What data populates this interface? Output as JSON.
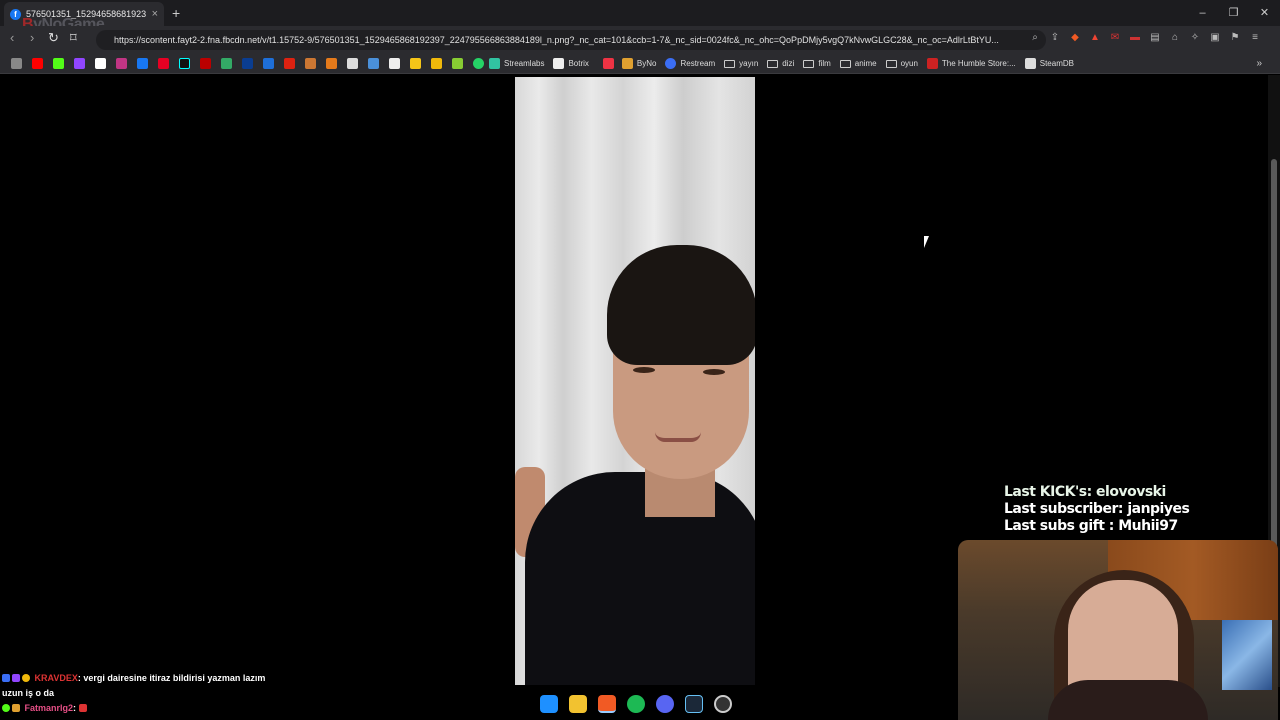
{
  "tab": {
    "title": "576501351_1529465868192397",
    "close": "×",
    "new": "+"
  },
  "watermark": {
    "part1": "B",
    "part2": "yNoGame"
  },
  "window": {
    "minimize": "–",
    "restore": "❐",
    "close": "✕"
  },
  "address": {
    "url": "https://scontent.fayt2-2.fna.fbcdn.net/v/t1.15752-9/576501351_1529465868192397_224795566863884189l_n.png?_nc_cat=101&ccb=1-7&_nc_sid=0024fc&_nc_ohc=QoPpDMjy5vgQ7kNvwGLGC28&_nc_oc=AdlrLtBtYU..."
  },
  "nav": {
    "back": "‹",
    "forward": "›",
    "reload": "↻",
    "bookmark": "⌑"
  },
  "bookmarks": [
    {
      "label": "Streamlabs",
      "color": "#31c3a2"
    },
    {
      "label": "Botrix",
      "color": "#eeeeee"
    },
    {
      "label": "ByNo",
      "color": "#e0a030"
    },
    {
      "label": "Restream",
      "color": "#3b6ef5"
    },
    {
      "label": "yayın",
      "folder": true
    },
    {
      "label": "dizi",
      "folder": true
    },
    {
      "label": "film",
      "folder": true
    },
    {
      "label": "anime",
      "folder": true
    },
    {
      "label": "oyun",
      "folder": true
    },
    {
      "label": "The Humble Store:...",
      "color": "#cc2222"
    },
    {
      "label": "SteamDB",
      "color": "#dddddd"
    }
  ],
  "overlay": {
    "last_kick": "Last KICK's: elovovski",
    "last_sub": "Last subscriber: janpiyes",
    "last_gift": "Last subs gift : Muhii97"
  },
  "chat": [
    {
      "user": "KRAVDEX",
      "text": ": vergi dairesine itiraz bildirisi yazman lazım"
    },
    {
      "user": "",
      "text": "uzun iş o da"
    },
    {
      "user": "Fatmanrlg2",
      "text": ": "
    }
  ],
  "colors": {
    "accent": "#1877f2",
    "overlay_text": "#ffffff"
  }
}
